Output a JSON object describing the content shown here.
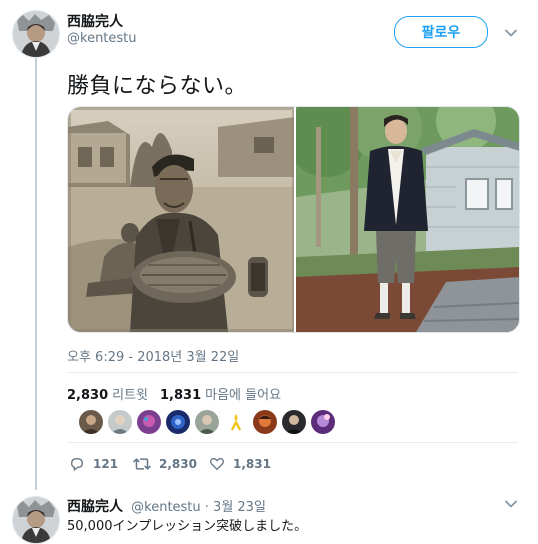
{
  "colors": {
    "accent": "#1da1f2",
    "muted": "#657786",
    "text": "#14171a",
    "thread_line": "#c4cfd6"
  },
  "tweet": {
    "display_name": "西脇完人",
    "username": "@kentestu",
    "follow_label": "팔로우",
    "text": "勝負にならない。",
    "timestamp": "오후 6:29 - 2018년 3월 22일",
    "retweets": {
      "count": "2,830",
      "label": "리트윗"
    },
    "likes": {
      "count": "1,831",
      "label": "마음에 들어요"
    },
    "actions": {
      "reply_count": "121",
      "retweet_count": "2,830",
      "like_count": "1,831"
    },
    "icons": {
      "more": "chevron-down-icon",
      "reply": "reply-icon",
      "retweet": "retweet-icon",
      "like": "heart-icon"
    }
  },
  "reply": {
    "display_name": "西脇完人",
    "meta": "@kentestu · 3월 23일",
    "text": "50,000インプレッション突破しました。"
  }
}
